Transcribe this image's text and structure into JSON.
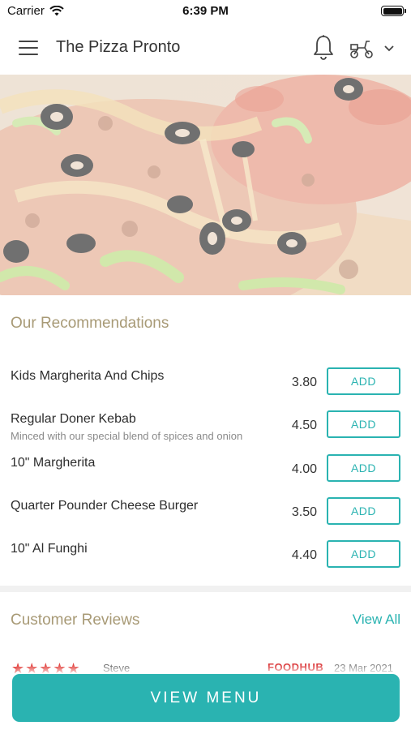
{
  "status_bar": {
    "carrier": "Carrier",
    "time": "6:39 PM"
  },
  "header": {
    "title": "The Pizza Pronto"
  },
  "recommendations": {
    "title": "Our Recommendations",
    "items": [
      {
        "name": "Kids Margherita And Chips",
        "description": "",
        "price": "3.80",
        "button": "ADD"
      },
      {
        "name": "Regular Doner Kebab",
        "description": "Minced with our special blend of spices and onion",
        "price": "4.50",
        "button": "ADD"
      },
      {
        "name": "10\" Margherita",
        "description": "",
        "price": "4.00",
        "button": "ADD"
      },
      {
        "name": "Quarter Pounder Cheese Burger",
        "description": "",
        "price": "3.50",
        "button": "ADD"
      },
      {
        "name": "10\" Al Funghi",
        "description": "",
        "price": "4.40",
        "button": "ADD"
      }
    ]
  },
  "reviews": {
    "title": "Customer Reviews",
    "view_all": "View All",
    "first": {
      "stars": "★★★★★",
      "reviewer": "Steve",
      "source": "FOODHUB",
      "date": "23 Mar 2021"
    }
  },
  "bottom_button": "VIEW MENU",
  "colors": {
    "accent": "#2ab3b1",
    "section_title": "#a89a76",
    "star": "#e0302c"
  }
}
